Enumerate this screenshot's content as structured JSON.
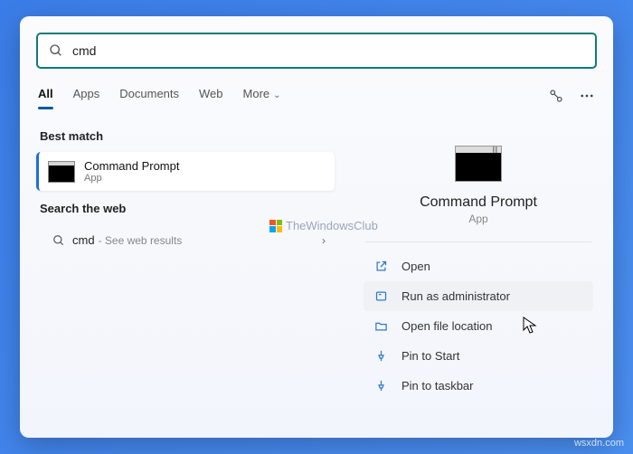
{
  "search": {
    "query": "cmd"
  },
  "tabs": {
    "all": "All",
    "apps": "Apps",
    "documents": "Documents",
    "web": "Web",
    "more": "More"
  },
  "sections": {
    "best_match": "Best match",
    "search_web": "Search the web"
  },
  "result": {
    "name": "Command Prompt",
    "kind": "App"
  },
  "web": {
    "term": "cmd",
    "hint": "See web results"
  },
  "preview": {
    "title": "Command Prompt",
    "kind": "App"
  },
  "actions": {
    "open": "Open",
    "run_admin": "Run as administrator",
    "open_loc": "Open file location",
    "pin_start": "Pin to Start",
    "pin_taskbar": "Pin to taskbar"
  },
  "watermark": "TheWindowsClub",
  "site": "wsxdn.com"
}
